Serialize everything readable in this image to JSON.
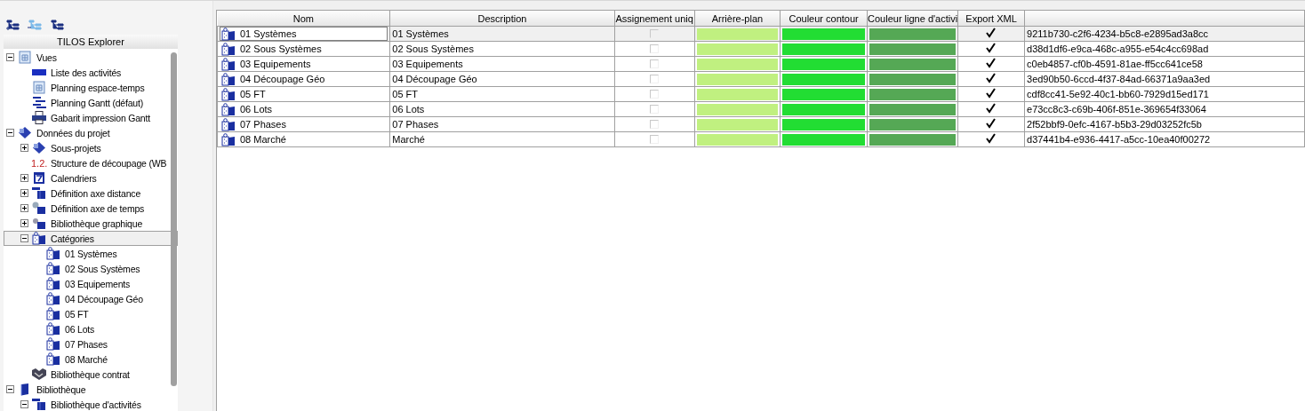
{
  "explorer": {
    "title": "TILOS Explorer",
    "tree": [
      {
        "label": "Vues",
        "kind": "views",
        "expanded": true,
        "selected": false,
        "children": [
          {
            "label": "Liste des activités",
            "kind": "bar",
            "selected": false
          },
          {
            "label": "Planning espace-temps",
            "kind": "views",
            "selected": false
          },
          {
            "label": "Planning Gantt (défaut)",
            "kind": "gantt",
            "selected": false
          },
          {
            "label": "Gabarit impression Gantt",
            "kind": "print",
            "selected": false
          }
        ]
      },
      {
        "label": "Données du projet",
        "kind": "project",
        "expanded": true,
        "selected": false,
        "children": [
          {
            "label": "Sous-projets",
            "kind": "project",
            "expanded": false,
            "selected": false
          },
          {
            "label": "Structure de découpage (WB",
            "kind": "number",
            "icon_text": "1.2.",
            "selected": false
          },
          {
            "label": "Calendriers",
            "kind": "calendar",
            "expanded": false,
            "selected": false
          },
          {
            "label": "Définition axe distance",
            "kind": "axis",
            "expanded": false,
            "selected": false
          },
          {
            "label": "Définition axe de temps",
            "kind": "time",
            "expanded": false,
            "selected": false
          },
          {
            "label": "Bibliothèque graphique",
            "kind": "graphic",
            "expanded": false,
            "selected": false
          },
          {
            "label": "Catégories",
            "kind": "category",
            "expanded": true,
            "selected": true,
            "children": [
              {
                "label": "01 Systèmes",
                "kind": "category",
                "selected": false
              },
              {
                "label": "02 Sous Systèmes",
                "kind": "category",
                "selected": false
              },
              {
                "label": "03 Equipements",
                "kind": "category",
                "selected": false
              },
              {
                "label": "04 Découpage Géo",
                "kind": "category",
                "selected": false
              },
              {
                "label": "05 FT",
                "kind": "category",
                "selected": false
              },
              {
                "label": "06 Lots",
                "kind": "category",
                "selected": false
              },
              {
                "label": "07 Phases",
                "kind": "category",
                "selected": false
              },
              {
                "label": "08 Marché",
                "kind": "category",
                "selected": false
              }
            ]
          },
          {
            "label": "Bibliothèque contrat",
            "kind": "contract",
            "selected": false
          }
        ]
      },
      {
        "label": "Bibliothèque",
        "kind": "book",
        "expanded": true,
        "selected": false,
        "children": [
          {
            "label": "Bibliothèque d'activités",
            "kind": "axis",
            "expanded": true,
            "selected": false
          }
        ]
      }
    ]
  },
  "table": {
    "columns": [
      "Nom",
      "Description",
      "Assignement uniq",
      "Arrière-plan",
      "Couleur contour",
      "Couleur ligne d'activi",
      "Export XML"
    ],
    "rows": [
      {
        "name": "01 Systèmes",
        "description": "01 Systèmes",
        "unique": false,
        "swatches": [
          {
            "color": "#c0f080"
          },
          {
            "color": "#22dd33"
          },
          {
            "color": "#55a855"
          }
        ],
        "export": true,
        "guid": "9211b730-c2f6-4234-b5c8-e2895ad3a8cc",
        "selected": true
      },
      {
        "name": "02 Sous Systèmes",
        "description": "02 Sous Systèmes",
        "unique": false,
        "swatches": [
          {
            "color": "#c0f080"
          },
          {
            "color": "#22dd33"
          },
          {
            "color": "#55a855"
          }
        ],
        "export": true,
        "guid": "d38d1df6-e9ca-468c-a955-e54c4cc698ad",
        "selected": false
      },
      {
        "name": "03 Equipements",
        "description": "03 Equipements",
        "unique": false,
        "swatches": [
          {
            "color": "#c0f080"
          },
          {
            "color": "#22dd33"
          },
          {
            "color": "#55a855"
          }
        ],
        "export": true,
        "guid": "c0eb4857-cf0b-4591-81ae-ff5cc641ce58",
        "selected": false
      },
      {
        "name": "04 Découpage Géo",
        "description": "04 Découpage Géo",
        "unique": false,
        "swatches": [
          {
            "color": "#c0f080"
          },
          {
            "color": "#22dd33"
          },
          {
            "color": "#55a855"
          }
        ],
        "export": true,
        "guid": "3ed90b50-6ccd-4f37-84ad-66371a9aa3ed",
        "selected": false
      },
      {
        "name": "05 FT",
        "description": "05 FT",
        "unique": false,
        "swatches": [
          {
            "color": "#c0f080"
          },
          {
            "color": "#22dd33"
          },
          {
            "color": "#55a855"
          }
        ],
        "export": true,
        "guid": "cdf8cc41-5e92-40c1-bb60-7929d15ed171",
        "selected": false
      },
      {
        "name": "06 Lots",
        "description": "06 Lots",
        "unique": false,
        "swatches": [
          {
            "color": "#c0f080"
          },
          {
            "color": "#22dd33"
          },
          {
            "color": "#55a855"
          }
        ],
        "export": true,
        "guid": "e73cc8c3-c69b-406f-851e-369654f33064",
        "selected": false
      },
      {
        "name": "07 Phases",
        "description": "07 Phases",
        "unique": false,
        "swatches": [
          {
            "color": "#c0f080"
          },
          {
            "color": "#22dd33"
          },
          {
            "color": "#55a855"
          }
        ],
        "export": true,
        "guid": "2f52bbf9-0efc-4167-b5b3-29d03252fc5b",
        "selected": false
      },
      {
        "name": "08 Marché",
        "description": "Marché",
        "unique": false,
        "swatches": [
          {
            "color": "#c0f080"
          },
          {
            "color": "#22dd33"
          },
          {
            "color": "#55a855"
          }
        ],
        "export": true,
        "guid": "d37441b4-e936-4417-a5cc-10ea40f00272",
        "selected": false
      }
    ]
  }
}
